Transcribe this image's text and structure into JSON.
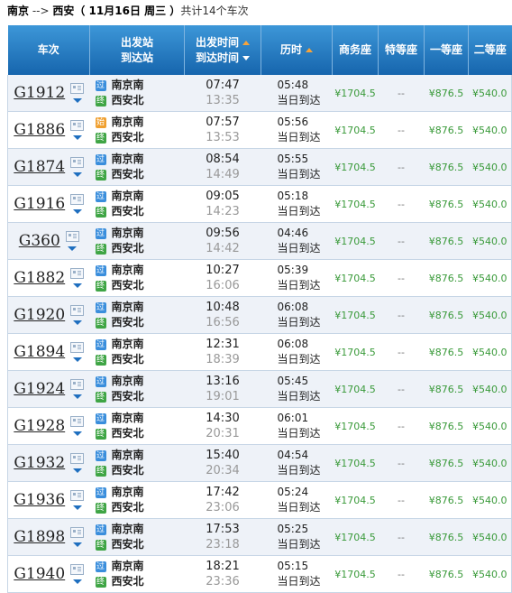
{
  "summary": {
    "from": "南京",
    "arrow": " --> ",
    "to": "西安",
    "date": "（ 11月16日  周三 ）",
    "count": "共计14个车次"
  },
  "headers": {
    "train": "车次",
    "station_dep": "出发站",
    "station_arr": "到达站",
    "time_dep": "出发时间",
    "time_arr": "到达时间",
    "duration": "历时",
    "business": "商务座",
    "special": "特等座",
    "first": "一等座",
    "second": "二等座"
  },
  "colors": {
    "header_bg": "#1d7cc4",
    "price_green": "#3a9a3a",
    "sort_arrow": "#f7a33a"
  },
  "trains": [
    {
      "no": "G1912",
      "dep_badge": "过",
      "dep_station": "南京南",
      "arr_station": "西安北",
      "dep_time": "07:47",
      "arr_time": "13:35",
      "duration": "05:48",
      "arrive_note": "当日到达",
      "business": "¥1704.5",
      "special": "--",
      "first": "¥876.5",
      "second": "¥540.0"
    },
    {
      "no": "G1886",
      "dep_badge": "始",
      "dep_station": "南京南",
      "arr_station": "西安北",
      "dep_time": "07:57",
      "arr_time": "13:53",
      "duration": "05:56",
      "arrive_note": "当日到达",
      "business": "¥1704.5",
      "special": "--",
      "first": "¥876.5",
      "second": "¥540.0"
    },
    {
      "no": "G1874",
      "dep_badge": "过",
      "dep_station": "南京南",
      "arr_station": "西安北",
      "dep_time": "08:54",
      "arr_time": "14:49",
      "duration": "05:55",
      "arrive_note": "当日到达",
      "business": "¥1704.5",
      "special": "--",
      "first": "¥876.5",
      "second": "¥540.0"
    },
    {
      "no": "G1916",
      "dep_badge": "过",
      "dep_station": "南京南",
      "arr_station": "西安北",
      "dep_time": "09:05",
      "arr_time": "14:23",
      "duration": "05:18",
      "arrive_note": "当日到达",
      "business": "¥1704.5",
      "special": "--",
      "first": "¥876.5",
      "second": "¥540.0"
    },
    {
      "no": "G360",
      "dep_badge": "过",
      "dep_station": "南京南",
      "arr_station": "西安北",
      "dep_time": "09:56",
      "arr_time": "14:42",
      "duration": "04:46",
      "arrive_note": "当日到达",
      "business": "¥1704.5",
      "special": "--",
      "first": "¥876.5",
      "second": "¥540.0"
    },
    {
      "no": "G1882",
      "dep_badge": "过",
      "dep_station": "南京南",
      "arr_station": "西安北",
      "dep_time": "10:27",
      "arr_time": "16:06",
      "duration": "05:39",
      "arrive_note": "当日到达",
      "business": "¥1704.5",
      "special": "--",
      "first": "¥876.5",
      "second": "¥540.0"
    },
    {
      "no": "G1920",
      "dep_badge": "过",
      "dep_station": "南京南",
      "arr_station": "西安北",
      "dep_time": "10:48",
      "arr_time": "16:56",
      "duration": "06:08",
      "arrive_note": "当日到达",
      "business": "¥1704.5",
      "special": "--",
      "first": "¥876.5",
      "second": "¥540.0"
    },
    {
      "no": "G1894",
      "dep_badge": "过",
      "dep_station": "南京南",
      "arr_station": "西安北",
      "dep_time": "12:31",
      "arr_time": "18:39",
      "duration": "06:08",
      "arrive_note": "当日到达",
      "business": "¥1704.5",
      "special": "--",
      "first": "¥876.5",
      "second": "¥540.0"
    },
    {
      "no": "G1924",
      "dep_badge": "过",
      "dep_station": "南京南",
      "arr_station": "西安北",
      "dep_time": "13:16",
      "arr_time": "19:01",
      "duration": "05:45",
      "arrive_note": "当日到达",
      "business": "¥1704.5",
      "special": "--",
      "first": "¥876.5",
      "second": "¥540.0"
    },
    {
      "no": "G1928",
      "dep_badge": "过",
      "dep_station": "南京南",
      "arr_station": "西安北",
      "dep_time": "14:30",
      "arr_time": "20:31",
      "duration": "06:01",
      "arrive_note": "当日到达",
      "business": "¥1704.5",
      "special": "--",
      "first": "¥876.5",
      "second": "¥540.0"
    },
    {
      "no": "G1932",
      "dep_badge": "过",
      "dep_station": "南京南",
      "arr_station": "西安北",
      "dep_time": "15:40",
      "arr_time": "20:34",
      "duration": "04:54",
      "arrive_note": "当日到达",
      "business": "¥1704.5",
      "special": "--",
      "first": "¥876.5",
      "second": "¥540.0"
    },
    {
      "no": "G1936",
      "dep_badge": "过",
      "dep_station": "南京南",
      "arr_station": "西安北",
      "dep_time": "17:42",
      "arr_time": "23:06",
      "duration": "05:24",
      "arrive_note": "当日到达",
      "business": "¥1704.5",
      "special": "--",
      "first": "¥876.5",
      "second": "¥540.0"
    },
    {
      "no": "G1898",
      "dep_badge": "过",
      "dep_station": "南京南",
      "arr_station": "西安北",
      "dep_time": "17:53",
      "arr_time": "23:18",
      "duration": "05:25",
      "arrive_note": "当日到达",
      "business": "¥1704.5",
      "special": "--",
      "first": "¥876.5",
      "second": "¥540.0"
    },
    {
      "no": "G1940",
      "dep_badge": "过",
      "dep_station": "南京南",
      "arr_station": "西安北",
      "dep_time": "18:21",
      "arr_time": "23:36",
      "duration": "05:15",
      "arrive_note": "当日到达",
      "business": "¥1704.5",
      "special": "--",
      "first": "¥876.5",
      "second": "¥540.0"
    }
  ],
  "arr_badge": "终"
}
